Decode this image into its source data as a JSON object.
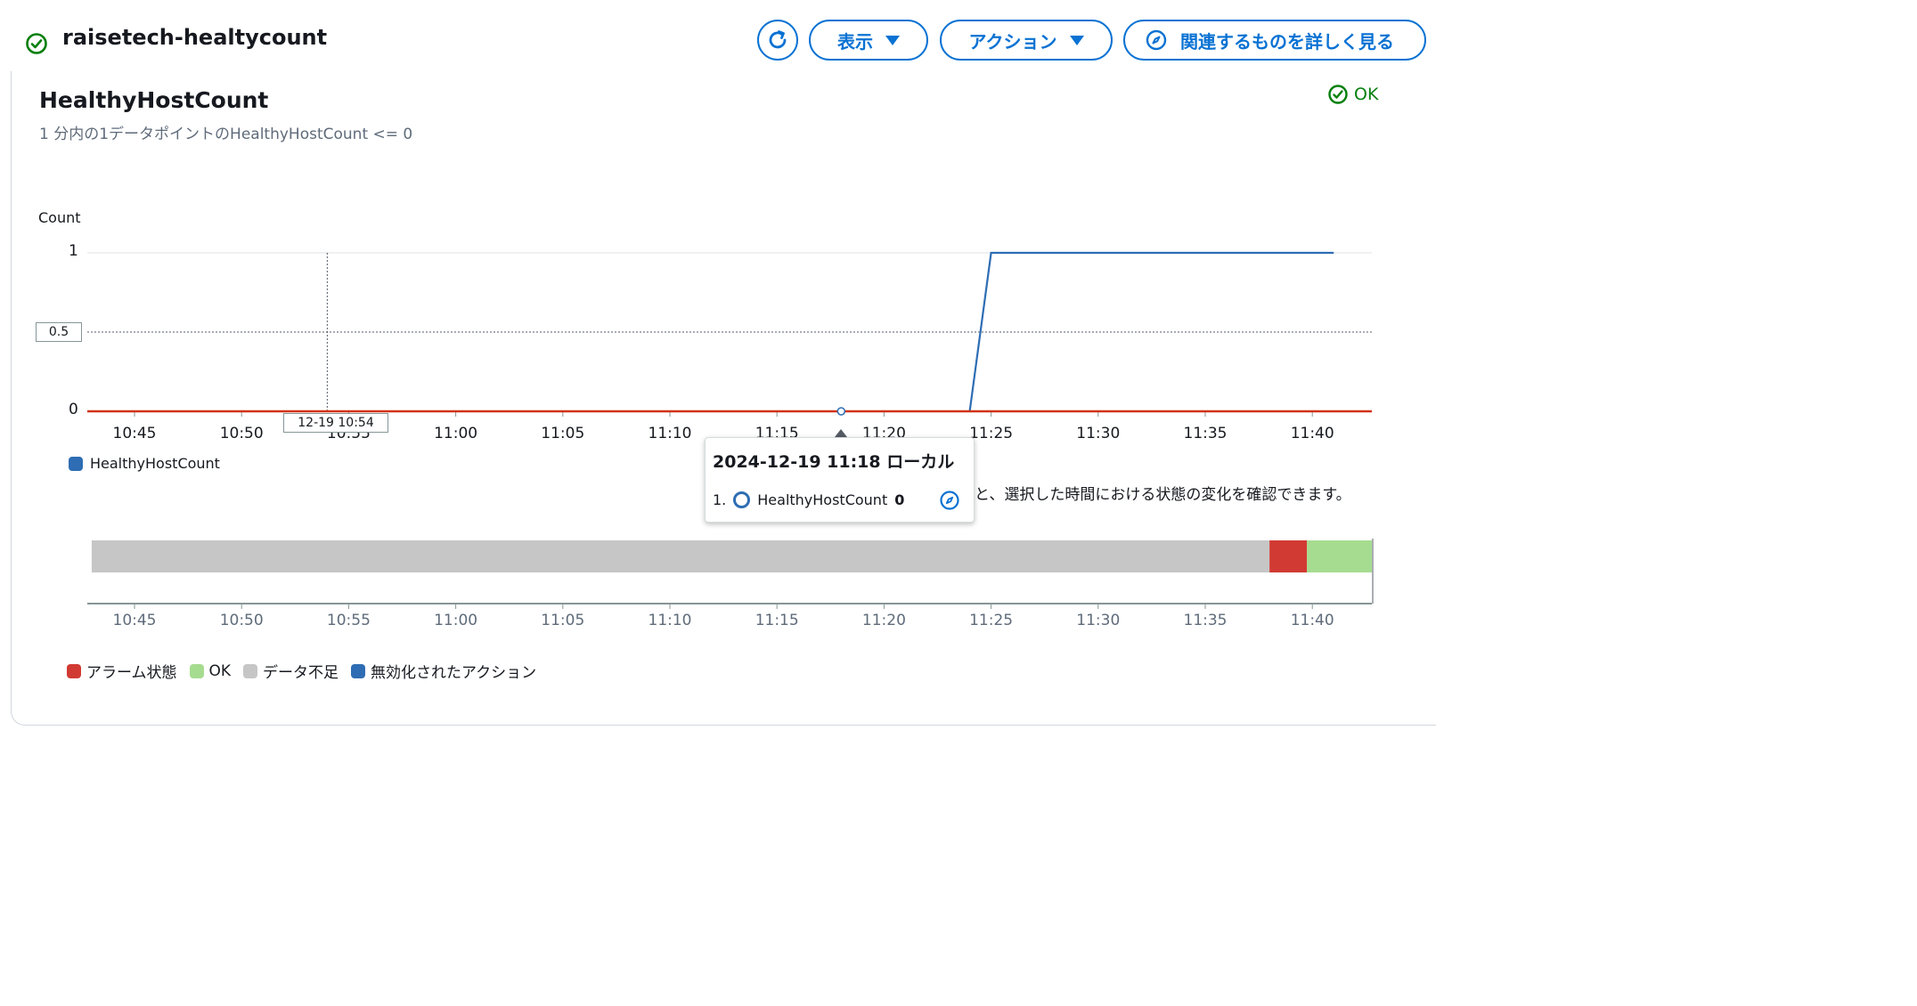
{
  "header": {
    "status_icon": "check-circle-icon",
    "title": "raisetech-healtycount",
    "buttons": {
      "refresh_icon": "refresh-icon",
      "display_label": "表示",
      "action_label": "アクション",
      "related_label": "関連するものを詳しく見る"
    }
  },
  "metric": {
    "title": "HealthyHostCount",
    "subtitle": "1 分内の1データポイントのHealthyHostCount <= 0",
    "status": "OK",
    "status_color": "#037f0c"
  },
  "chart_data": {
    "type": "line",
    "ylabel": "Count",
    "ylim": [
      0,
      1
    ],
    "yticks": [
      "1",
      "0.5",
      "0"
    ],
    "xticks": [
      "10:45",
      "10:50",
      "10:55",
      "11:00",
      "11:05",
      "11:10",
      "11:15",
      "11:20",
      "11:25",
      "11:30",
      "11:35",
      "11:40"
    ],
    "threshold": {
      "value": 0,
      "color": "#d13212"
    },
    "series": [
      {
        "name": "HealthyHostCount",
        "color": "#2e6db4",
        "points": [
          {
            "x": "11:24",
            "y": 0
          },
          {
            "x": "11:25",
            "y": 1
          },
          {
            "x": "11:41",
            "y": 1
          }
        ]
      }
    ],
    "cursor_label": "12-19 10:54",
    "hover_marker": {
      "x": "11:18",
      "y": 0
    }
  },
  "tooltip": {
    "title": "2024-12-19 11:18 ローカル",
    "index": "1.",
    "series": "HealthyHostCount",
    "value": "0",
    "compass_icon": "compass-icon"
  },
  "hint_text": "と、選択した時間における状態の変化を確認できます。",
  "state_timeline": {
    "xticks": [
      "10:45",
      "10:50",
      "10:55",
      "11:00",
      "11:05",
      "11:10",
      "11:15",
      "11:20",
      "11:25",
      "11:30",
      "11:35",
      "11:40"
    ],
    "segments": [
      {
        "state": "データ不足",
        "from": "10:43",
        "to": "11:38",
        "color": "#c6c6c6"
      },
      {
        "state": "アラーム状態",
        "from": "11:38",
        "to": "11:39:45",
        "color": "#d13a33"
      },
      {
        "state": "OK",
        "from": "11:39:45",
        "to": "11:43",
        "color": "#a6dc90"
      }
    ]
  },
  "state_legend": [
    {
      "label": "アラーム状態",
      "color": "#d13a33"
    },
    {
      "label": "OK",
      "color": "#a6dc90"
    },
    {
      "label": "データ不足",
      "color": "#c6c6c6"
    },
    {
      "label": "無効化されたアクション",
      "color": "#2e6db4"
    }
  ]
}
